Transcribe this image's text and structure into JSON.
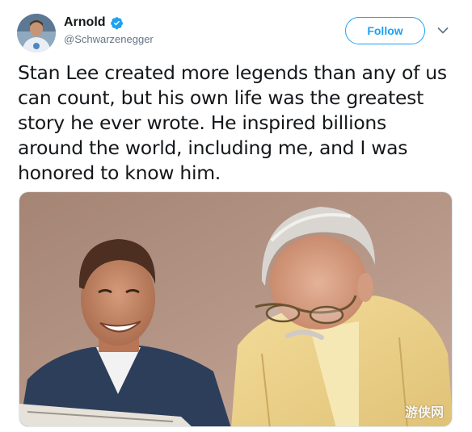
{
  "user": {
    "display_name": "Arnold",
    "handle": "@Schwarzenegger",
    "verified": true,
    "avatar_icon": "profile-photo"
  },
  "actions": {
    "follow_label": "Follow",
    "more_icon": "chevron-down-icon"
  },
  "tweet": {
    "text_lines": [
      "Stan Lee created more legends than any of us",
      "can count, but his own life was the greatest",
      "story he ever wrote. He inspired billions",
      "around the world, including me, and I was",
      "honored to know him."
    ]
  },
  "media": {
    "type": "photo",
    "watermark": "游侠网"
  },
  "colors": {
    "accent": "#1da1f2",
    "text": "#14171a",
    "secondary_text": "#657786",
    "border": "#e1e8ed"
  }
}
